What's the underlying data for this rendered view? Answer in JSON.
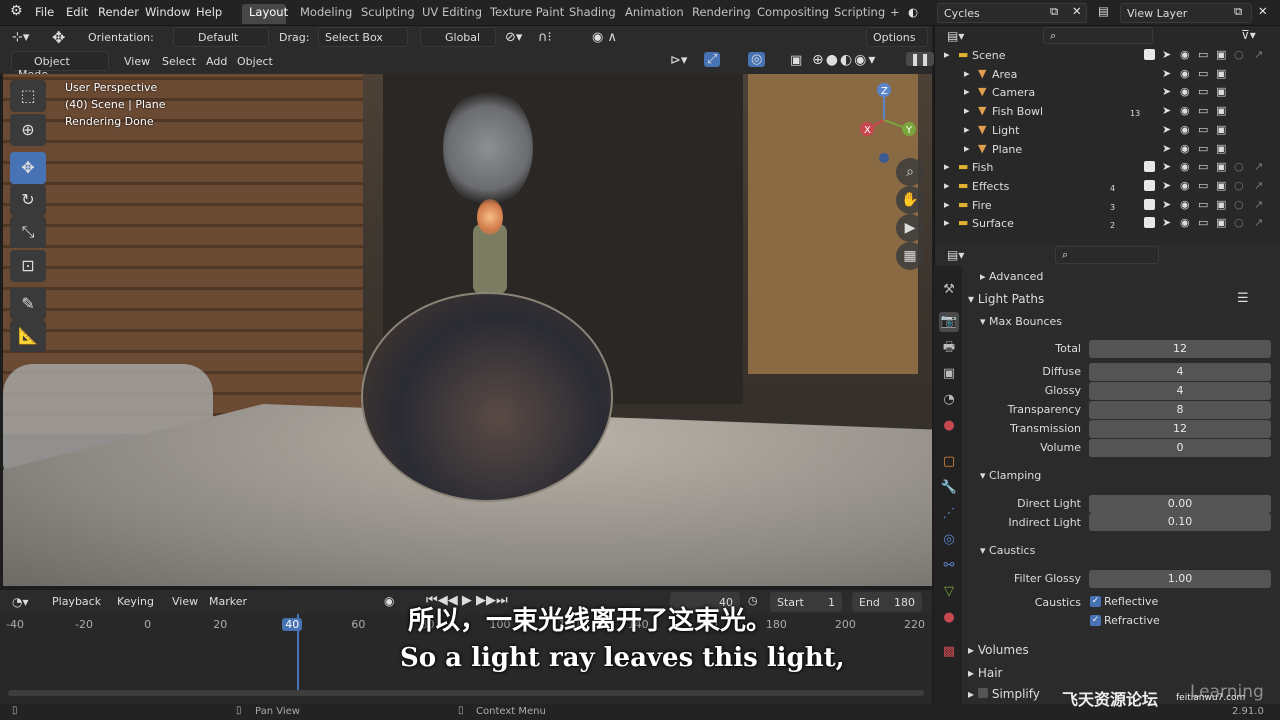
{
  "topbar": {
    "menus": [
      "File",
      "Edit",
      "Render",
      "Window",
      "Help"
    ],
    "workspaces": [
      "Layout",
      "Modeling",
      "Sculpting",
      "UV Editing",
      "Texture Paint",
      "Shading",
      "Animation",
      "Rendering",
      "Compositing",
      "Scripting"
    ],
    "active_workspace": "Layout",
    "add_tab": "+",
    "engine": "Cycles",
    "view_layer": "View Layer"
  },
  "viewport_header": {
    "orientation_label": "Orientation:",
    "orientation_value": "Default",
    "drag_label": "Drag:",
    "drag_value": "Select Box",
    "transform_value": "Global",
    "options_label": "Options",
    "mode": "Object Mode",
    "menus": [
      "View",
      "Select",
      "Add",
      "Object"
    ]
  },
  "viewport_overlay": {
    "line1": "User Perspective",
    "line2": "(40) Scene | Plane",
    "line3": "Rendering Done"
  },
  "gizmo": {
    "z": "Z",
    "x": "X",
    "y": "Y"
  },
  "outliner": {
    "rows": [
      {
        "name": "Scene",
        "indent": 0
      },
      {
        "name": "Area",
        "indent": 1
      },
      {
        "name": "Camera",
        "indent": 1
      },
      {
        "name": "Fish Bowl",
        "indent": 1,
        "badge": "13"
      },
      {
        "name": "Light",
        "indent": 1
      },
      {
        "name": "Plane",
        "indent": 1
      },
      {
        "name": "Fish",
        "indent": 0
      },
      {
        "name": "Effects",
        "indent": 0,
        "badge": "4"
      },
      {
        "name": "Fire",
        "indent": 0,
        "badge": "3"
      },
      {
        "name": "Surface",
        "indent": 0,
        "badge": "2"
      }
    ]
  },
  "properties": {
    "advanced": "Advanced",
    "light_paths": "Light Paths",
    "max_bounces": "Max Bounces",
    "bounces": [
      {
        "label": "Total",
        "value": "12"
      },
      {
        "label": "Diffuse",
        "value": "4"
      },
      {
        "label": "Glossy",
        "value": "4"
      },
      {
        "label": "Transparency",
        "value": "8"
      },
      {
        "label": "Transmission",
        "value": "12"
      },
      {
        "label": "Volume",
        "value": "0"
      }
    ],
    "clamping": "Clamping",
    "clamp": [
      {
        "label": "Direct Light",
        "value": "0.00"
      },
      {
        "label": "Indirect Light",
        "value": "0.10"
      }
    ],
    "caustics": "Caustics",
    "filter_glossy_label": "Filter Glossy",
    "filter_glossy_value": "1.00",
    "caustics_label": "Caustics",
    "reflective": "Reflective",
    "refractive": "Refractive",
    "volumes": "Volumes",
    "hair": "Hair",
    "simplify": "Simplify"
  },
  "timeline": {
    "menus": [
      "Playback",
      "Keying",
      "View",
      "Marker"
    ],
    "current_frame": "40",
    "start_label": "Start",
    "start_value": "1",
    "end_label": "End",
    "end_value": "180",
    "ticks": [
      "-40",
      "-20",
      "0",
      "20",
      "40",
      "60",
      "80",
      "100",
      "120",
      "140",
      "160",
      "180",
      "200",
      "220"
    ]
  },
  "statusbar": {
    "pan": "Pan View",
    "context": "Context Menu",
    "version": "2.91.0"
  },
  "subtitles": {
    "cn": "所以，一束光线离开了这束光。",
    "en": "So a light ray leaves this light,"
  },
  "watermark": {
    "site_cn": "飞天资源论坛",
    "site_url": "feitianwu7.com",
    "brand": "Learning"
  },
  "colors": {
    "accent": "#4772b3",
    "bg_dark": "#232323",
    "panel": "#2b2b2b",
    "playhead": "#4772b3"
  }
}
